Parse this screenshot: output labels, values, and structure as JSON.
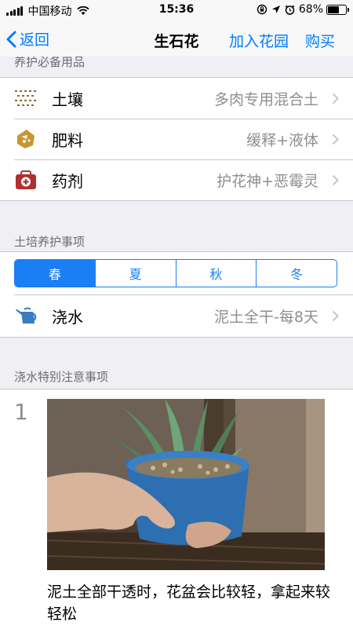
{
  "status_bar": {
    "carrier": "中国移动",
    "time": "15:36",
    "battery": "68%",
    "battery_level": 0.68
  },
  "nav": {
    "back_label": "返回",
    "title": "生石花",
    "add_garden_label": "加入花园",
    "buy_label": "购买"
  },
  "supplies": {
    "header": "养护必备用品",
    "items": [
      {
        "label": "土壤",
        "value": "多肉专用混合土",
        "icon": "soil-icon"
      },
      {
        "label": "肥料",
        "value": "缓释+液体",
        "icon": "fertilizer-icon"
      },
      {
        "label": "药剂",
        "value": "护花神+恶霉灵",
        "icon": "medicine-kit-icon"
      }
    ]
  },
  "care": {
    "header": "土培养护事项",
    "seasons": [
      "春",
      "夏",
      "秋",
      "冬"
    ],
    "active_season": 0,
    "watering": {
      "label": "浇水",
      "value": "泥土全干-每8天",
      "icon": "watering-can-icon"
    }
  },
  "watering_notes": {
    "header": "浇水特别注意事项",
    "items": [
      {
        "number": "1",
        "text": "泥土全部干透时，花盆会比较轻，拿起来较轻松"
      }
    ]
  },
  "colors": {
    "accent": "#007aff",
    "segment": "#1a7ef5",
    "background": "#efeff4"
  }
}
